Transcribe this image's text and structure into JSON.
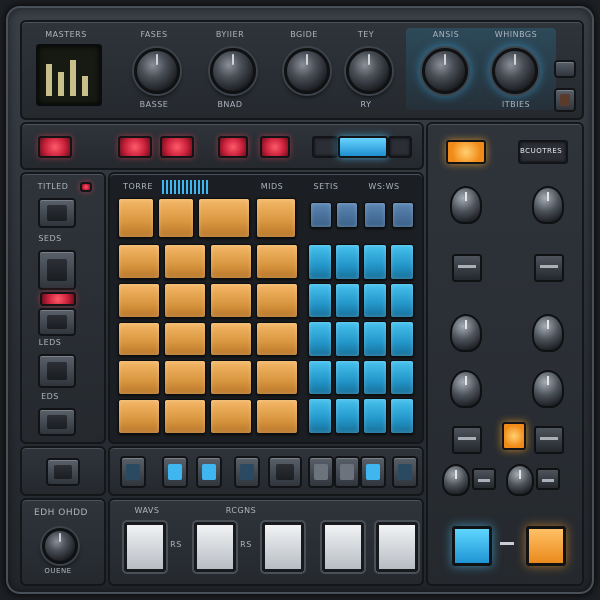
{
  "top": {
    "display_label": "MASTERS",
    "knob_labels": [
      "FASES",
      "BYIIER",
      "BGIDE",
      "TEY",
      "ANSIS",
      "WHINBGS"
    ],
    "knob_sublabels": [
      "BASSE",
      "BNAD",
      "",
      "RY",
      "",
      "ITBIES"
    ]
  },
  "transport": {
    "right_display": "BCUOTRES"
  },
  "grid_header": {
    "labels": [
      "TORRE",
      "MIDS",
      "SETIS",
      "WS:WS"
    ]
  },
  "left_column": {
    "labels": [
      "TITLED",
      "SEDS",
      "LEDS",
      "EDS"
    ]
  },
  "bottom": {
    "left_label": "EDH OHDD",
    "left_sublabel": "OUENE",
    "section_labels": [
      "WAVS",
      "RCGNS"
    ],
    "between_labels": [
      "RS",
      "RS"
    ]
  },
  "colors": {
    "pad_orange": "#e3a04e",
    "pad_blue": "#2aa2d4",
    "led_red": "#e2334a",
    "led_blue": "#3fb6ef",
    "led_orange": "#f59a26"
  }
}
